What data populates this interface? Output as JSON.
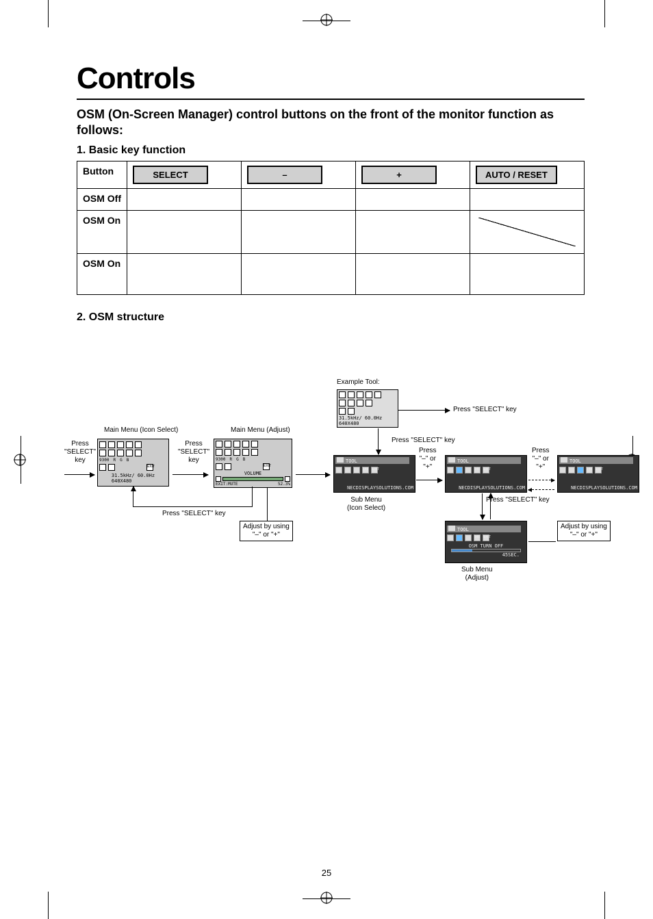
{
  "page_title": "Controls",
  "subtitle": "OSM (On-Screen Manager) control buttons on the front of the monitor function as follows:",
  "section1": "1. Basic key function",
  "section2": "2. OSM structure",
  "table": {
    "headers": [
      "Button",
      "SELECT",
      "–",
      "+",
      "AUTO / RESET"
    ],
    "rows": [
      {
        "label": "OSM Off"
      },
      {
        "label": "OSM On"
      },
      {
        "label": "OSM On"
      }
    ]
  },
  "osm": {
    "example_tool": "Example Tool:",
    "main_menu_icon": "Main Menu (Icon Select)",
    "main_menu_adjust": "Main Menu (Adjust)",
    "press_select": "Press \"SELECT\" key",
    "press_select_multiline": "Press\n\"SELECT\"\nkey",
    "press_minus_plus": "Press\n\"–\" or\n\"+\"",
    "adjust_by": "Adjust by using\n\"–\" or \"+\"",
    "sub_menu_icon": "Sub Menu\n(Icon Select)",
    "sub_menu_adjust": "Sub Menu\n(Adjust)",
    "freq": "31.5kHz/ 60.0Hz\n640X480",
    "volume": "VOLUME",
    "mute": "EXIT:MUTE",
    "tool": "TOOL",
    "url": "NECDISPLAYSOLUTIONS.COM",
    "osm_off": "OSM TURN OFF",
    "sec45": "45SEC.",
    "pct": "52.3%"
  },
  "page_number": "25"
}
